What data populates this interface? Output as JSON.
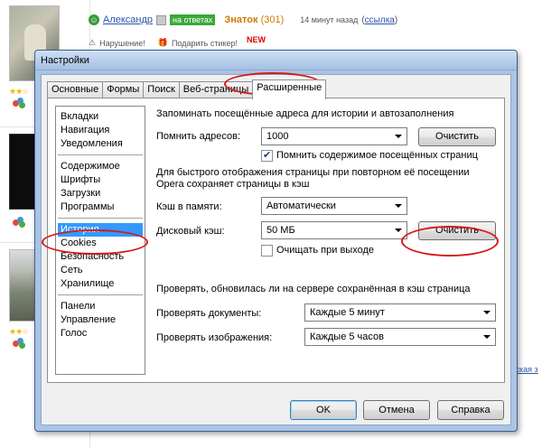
{
  "background": {
    "author": {
      "name": "Александр",
      "status_tag": "на ответах",
      "rank": "Знаток",
      "rank_points": "(301)",
      "time": "14 минут назад",
      "ref_open": "(",
      "ref_link": "ссылка",
      "ref_close": ")"
    },
    "actions": {
      "report": "Нарушение!",
      "gift": "Подарить стикер!",
      "new_badge": "NEW"
    },
    "side_link": "сская з"
  },
  "dialog": {
    "title": "Настройки",
    "tabs": [
      "Основные",
      "Формы",
      "Поиск",
      "Веб-страницы",
      "Расширенные"
    ],
    "active_tab": "Расширенные",
    "categories": [
      [
        "Вкладки",
        "Навигация",
        "Уведомления"
      ],
      [
        "Содержимое",
        "Шрифты",
        "Загрузки",
        "Программы"
      ],
      [
        "История",
        "Cookies",
        "Безопасность",
        "Сеть",
        "Хранилище"
      ],
      [
        "Панели",
        "Управление",
        "Голос"
      ]
    ],
    "selected_category": "История",
    "history": {
      "heading": "Запоминать посещённые адреса для истории и автозаполнения",
      "remember_label": "Помнить адресов:",
      "remember_value": "1000",
      "clear_label": "Очистить",
      "remember_content_label": "Помнить содержимое посещённых страниц",
      "remember_content_checked": true
    },
    "cache": {
      "heading_line1": "Для быстрого отображения страницы при повторном её посещении",
      "heading_line2": "Opera сохраняет страницы в кэш",
      "memory_label": "Кэш в памяти:",
      "memory_value": "Автоматически",
      "disk_label": "Дисковый кэш:",
      "disk_value": "50 МБ",
      "clear_label": "Очистить",
      "clear_on_exit_label": "Очищать при выходе",
      "clear_on_exit_checked": false
    },
    "check": {
      "heading": "Проверять, обновилась ли на сервере сохранённая в кэш страница",
      "docs_label": "Проверять документы:",
      "docs_value": "Каждые 5 минут",
      "images_label": "Проверять изображения:",
      "images_value": "Каждые 5 часов"
    },
    "buttons": {
      "ok": "OK",
      "cancel": "Отмена",
      "help": "Справка"
    },
    "highlight_color": "#d61a1a",
    "selection_color": "#3399ff"
  }
}
